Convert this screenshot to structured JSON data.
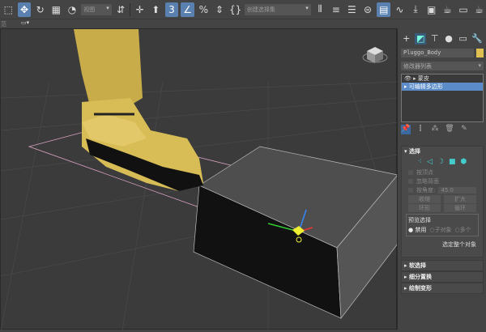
{
  "toolbar": {
    "view_dropdown": "视图",
    "selection_set_dropdown": "创建选择集",
    "snap_label": "3",
    "percent_label": "%"
  },
  "toolbar2": {
    "label": "范"
  },
  "panel": {
    "object_name": "Pluggo_Body",
    "object_color": "#e0c050",
    "modifier_list": "修改器列表",
    "stack": [
      "蒙皮",
      "可编辑多边形"
    ],
    "selection": {
      "title": "选择",
      "by_vertex": "按顶点",
      "ignore_backfacing": "忽略背面",
      "by_angle": "按角度:",
      "angle_value": "45.0",
      "shrink": "收缩",
      "grow": "扩大",
      "ring": "环形",
      "loop": "循环",
      "preview_title": "预览选择",
      "preview_options": [
        "禁用",
        "子对象",
        "多个"
      ],
      "status": "选定整个对象"
    },
    "rollouts": [
      "软选择",
      "细分置换",
      "绘制变形"
    ]
  }
}
